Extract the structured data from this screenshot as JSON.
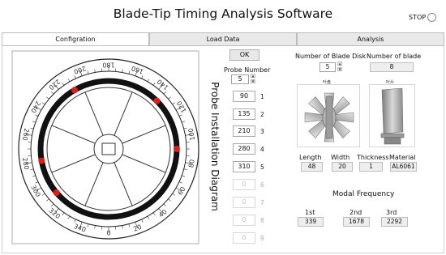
{
  "window": {
    "title": "Blade-Tip Timing Analysis Software",
    "stop_label": "STOP"
  },
  "tabs": [
    {
      "label": "Configration",
      "active": true
    },
    {
      "label": "Load Data",
      "active": false
    },
    {
      "label": "Analysis",
      "active": false
    }
  ],
  "wheel": {
    "scale_ticks": [
      "0",
      "20",
      "40",
      "60",
      "80",
      "100",
      "120",
      "140",
      "160",
      "180",
      "200",
      "220",
      "240",
      "260",
      "280",
      "300",
      "320",
      "340"
    ],
    "probe_marker_color": "#e31b1b"
  },
  "probes": {
    "ok_label": "OK",
    "number_label": "Probe Number",
    "number_value": "5",
    "vertical_title": "Probe Installation Diagram",
    "angles": [
      {
        "value": "90",
        "index": "1",
        "enabled": true
      },
      {
        "value": "135",
        "index": "2",
        "enabled": true
      },
      {
        "value": "210",
        "index": "3",
        "enabled": true
      },
      {
        "value": "280",
        "index": "4",
        "enabled": true
      },
      {
        "value": "310",
        "index": "5",
        "enabled": true
      },
      {
        "value": "0",
        "index": "6",
        "enabled": false
      },
      {
        "value": "0",
        "index": "7",
        "enabled": false
      },
      {
        "value": "0",
        "index": "8",
        "enabled": false
      },
      {
        "value": "0",
        "index": "9",
        "enabled": false
      }
    ]
  },
  "disk": {
    "num_disk_label": "Number of Blade Disk",
    "num_disk_value": "5",
    "num_blade_label": "Number of blade",
    "num_blade_value": "8",
    "image1_caption": "叶盘",
    "image2_caption": "叶片",
    "props": [
      {
        "label": "Length",
        "value": "48"
      },
      {
        "label": "Width",
        "value": "20"
      },
      {
        "label": "Thickness",
        "value": "1"
      },
      {
        "label": "Material",
        "value": "AL6061"
      }
    ]
  },
  "modal": {
    "title": "Modal Frequency",
    "items": [
      {
        "label": "1st",
        "value": "339"
      },
      {
        "label": "2nd",
        "value": "1678"
      },
      {
        "label": "3rd",
        "value": "2292"
      }
    ]
  }
}
